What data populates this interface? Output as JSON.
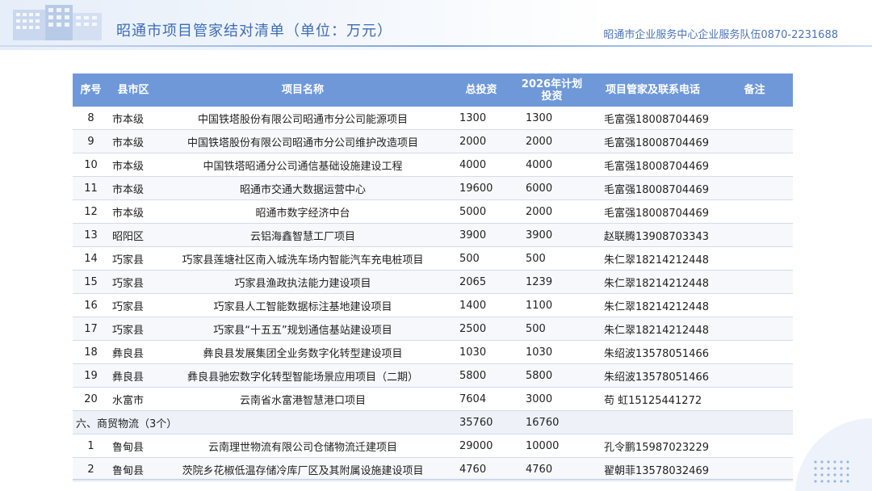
{
  "header": {
    "title": "昭通市项目管家结对清单（单位：万元）",
    "org": "昭通市企业服务中心企业服务队伍0870-2231688"
  },
  "colors": {
    "accent": "#6f98d9",
    "title": "#3d6cb5"
  },
  "table": {
    "columns": [
      "序号",
      "县市区",
      "项目名称",
      "总投资",
      "2026年计划投资",
      "项目管家及联系电话",
      "备注"
    ],
    "rows": [
      {
        "num": "8",
        "district": "市本级",
        "name": "中国铁塔股份有限公司昭通市分公司能源项目",
        "invest": "1300",
        "plan": "1300",
        "manager": "毛富强18008704469",
        "note": ""
      },
      {
        "num": "9",
        "district": "市本级",
        "name": "中国铁塔股份有限公司昭通市分公司维护改造项目",
        "invest": "2000",
        "plan": "2000",
        "manager": "毛富强18008704469",
        "note": ""
      },
      {
        "num": "10",
        "district": "市本级",
        "name": "中国铁塔昭通分公司通信基础设施建设工程",
        "invest": "4000",
        "plan": "4000",
        "manager": "毛富强18008704469",
        "note": ""
      },
      {
        "num": "11",
        "district": "市本级",
        "name": "昭通市交通大数据运营中心",
        "invest": "19600",
        "plan": "6000",
        "manager": "毛富强18008704469",
        "note": ""
      },
      {
        "num": "12",
        "district": "市本级",
        "name": "昭通市数字经济中台",
        "invest": "5000",
        "plan": "2000",
        "manager": "毛富强18008704469",
        "note": ""
      },
      {
        "num": "13",
        "district": "昭阳区",
        "name": "云铝海鑫智慧工厂项目",
        "invest": "3900",
        "plan": "3900",
        "manager": "赵联腾13908703343",
        "note": ""
      },
      {
        "num": "14",
        "district": "巧家县",
        "name": "巧家县莲塘社区南入城洗车场内智能汽车充电桩项目",
        "invest": "500",
        "plan": "500",
        "manager": "朱仁翠18214212448",
        "note": ""
      },
      {
        "num": "15",
        "district": "巧家县",
        "name": "巧家县渔政执法能力建设项目",
        "invest": "2065",
        "plan": "1239",
        "manager": "朱仁翠18214212448",
        "note": ""
      },
      {
        "num": "16",
        "district": "巧家县",
        "name": "巧家县人工智能数据标注基地建设项目",
        "invest": "1400",
        "plan": "1100",
        "manager": "朱仁翠18214212448",
        "note": ""
      },
      {
        "num": "17",
        "district": "巧家县",
        "name": "巧家县“十五五”规划通信基站建设项目",
        "invest": "2500",
        "plan": "500",
        "manager": "朱仁翠18214212448",
        "note": ""
      },
      {
        "num": "18",
        "district": "彝良县",
        "name": "彝良县发展集团全业务数字化转型建设项目",
        "invest": "1030",
        "plan": "1030",
        "manager": "朱绍波13578051466",
        "note": ""
      },
      {
        "num": "19",
        "district": "彝良县",
        "name": "彝良县驰宏数字化转型智能场景应用项目（二期）",
        "invest": "5800",
        "plan": "5800",
        "manager": "朱绍波13578051466",
        "note": ""
      },
      {
        "num": "20",
        "district": "水富市",
        "name": "云南省水富港智慧港口项目",
        "invest": "7604",
        "plan": "3000",
        "manager": "苟  虹15125441272",
        "note": ""
      }
    ],
    "section": {
      "label": "六、商贸物流（3个）",
      "invest": "35760",
      "plan": "16760"
    },
    "rows2": [
      {
        "num": "1",
        "district": "鲁甸县",
        "name": "云南理世物流有限公司仓储物流迁建项目",
        "invest": "29000",
        "plan": "10000",
        "manager": "孔令鹏15987023229",
        "note": ""
      },
      {
        "num": "2",
        "district": "鲁甸县",
        "name": "茨院乡花椒低温存储冷库厂区及其附属设施建设项目",
        "invest": "4760",
        "plan": "4760",
        "manager": "翟朝菲13578032469",
        "note": ""
      }
    ]
  }
}
